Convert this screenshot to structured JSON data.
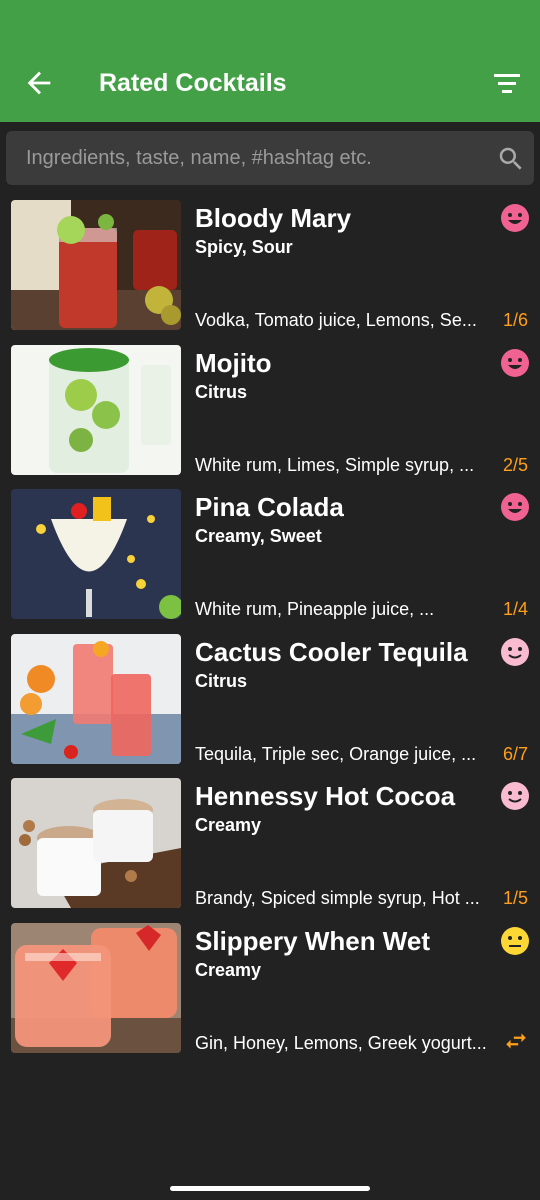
{
  "header": {
    "title": "Rated Cocktails",
    "back_icon": "arrow-back-icon",
    "filter_icon": "filter-list-icon",
    "color": "#43a047"
  },
  "search": {
    "placeholder": "Ingredients, taste, name, #hashtag etc.",
    "value": "",
    "icon": "search-icon"
  },
  "colors": {
    "accent": "#ff9f1a",
    "background": "#222222",
    "happy": "#f06292",
    "content": "#f8bbd0",
    "neutral": "#fdd835"
  },
  "cocktails": [
    {
      "name": "Bloody Mary",
      "taste": "Spicy, Sour",
      "ingredients": "Vodka, Tomato juice, Lemons, Se...",
      "counter": "1/6",
      "rating_icon": "laughing-face-icon"
    },
    {
      "name": "Mojito",
      "taste": "Citrus",
      "ingredients": "White rum, Limes, Simple syrup, ...",
      "counter": "2/5",
      "rating_icon": "laughing-face-icon"
    },
    {
      "name": "Pina Colada",
      "taste": "Creamy, Sweet",
      "ingredients": "White rum, Pineapple juice, ...",
      "counter": "1/4",
      "rating_icon": "laughing-face-icon"
    },
    {
      "name": "Cactus Cooler Tequila",
      "taste": "Citrus",
      "ingredients": "Tequila, Triple sec, Orange juice, ...",
      "counter": "6/7",
      "rating_icon": "smiling-face-icon"
    },
    {
      "name": "Hennessy Hot Cocoa",
      "taste": "Creamy",
      "ingredients": "Brandy, Spiced simple syrup, Hot ...",
      "counter": "1/5",
      "rating_icon": "smiling-face-icon"
    },
    {
      "name": "Slippery When Wet",
      "taste": "Creamy",
      "ingredients": "Gin, Honey, Lemons, Greek yogurt...",
      "counter": "",
      "rating_icon": "neutral-face-icon",
      "action_icon": "swap-icon"
    }
  ]
}
